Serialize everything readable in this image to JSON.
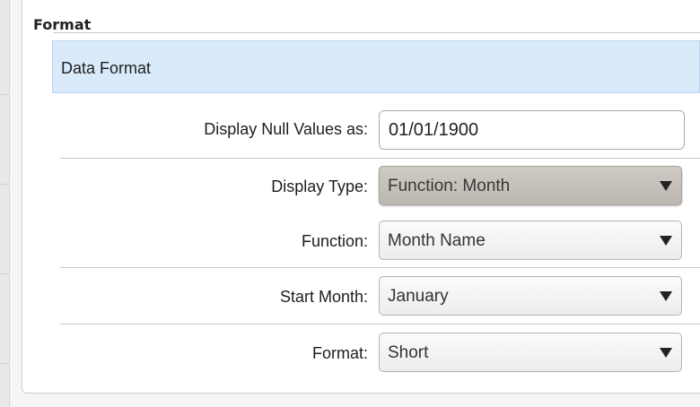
{
  "panel": {
    "title": "Format"
  },
  "section": {
    "title": "Data Format"
  },
  "fields": {
    "null_values": {
      "label": "Display Null Values as:",
      "value": "01/01/1900"
    },
    "display_type": {
      "label": "Display Type:",
      "selected": "Function: Month"
    },
    "function": {
      "label": "Function:",
      "selected": "Month Name"
    },
    "start_month": {
      "label": "Start Month:",
      "selected": "January"
    },
    "format": {
      "label": "Format:",
      "selected": "Short"
    }
  },
  "icons": {
    "dropdown": "triangle-down-icon"
  },
  "colors": {
    "section_bar": "#d9eafb",
    "active_select": "#c6c0ba"
  }
}
